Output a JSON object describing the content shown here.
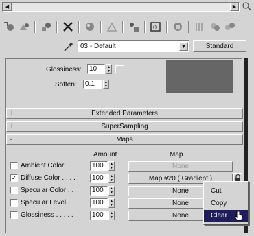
{
  "top_scroll": {
    "left_arrow": "◀",
    "right_arrow": "▶"
  },
  "toolbar": {
    "icons": [
      "get-material-icon",
      "put-to-scene-icon",
      "assign-material-icon",
      "delete-icon",
      "make-copy-icon",
      "make-unique-icon",
      "put-to-library-icon",
      "material-id-channel-icon",
      "show-map-icon",
      "show-end-result-icon",
      "go-to-parent-icon",
      "go-forward-icon",
      "pick-material-icon"
    ]
  },
  "material": {
    "name": "03 - Default",
    "type": "Standard"
  },
  "params": {
    "glossiness_label": "Glossiness:",
    "glossiness_value": "10",
    "soften_label": "Soften:",
    "soften_value": "0.1"
  },
  "rollouts": {
    "extended": {
      "sign": "+",
      "label": "Extended Parameters"
    },
    "supersampling": {
      "sign": "+",
      "label": "SuperSampling"
    },
    "maps": {
      "sign": "-",
      "label": "Maps"
    }
  },
  "maps": {
    "amount_header": "Amount",
    "map_header": "Map",
    "rows": [
      {
        "label": "Ambient Color . .",
        "checked": false,
        "amount": "100",
        "map": "None",
        "disabled": true
      },
      {
        "label": "Diffuse Color . . . .",
        "checked": true,
        "amount": "100",
        "map": "Map #20  ( Gradient )",
        "disabled": false
      },
      {
        "label": "Specular Color . .",
        "checked": false,
        "amount": "100",
        "map": "None",
        "disabled": false
      },
      {
        "label": "Specular Level .",
        "checked": false,
        "amount": "100",
        "map": "None",
        "disabled": false
      },
      {
        "label": "Glossiness . . . . .",
        "checked": false,
        "amount": "100",
        "map": "None",
        "disabled": false
      }
    ]
  },
  "context_menu": {
    "items": [
      "Cut",
      "Copy",
      "Clear"
    ],
    "highlighted": "Clear"
  },
  "colors": {
    "panel_bg": "#d4d4d4",
    "swatch": "#666666",
    "highlight": "#1e1e5a"
  }
}
